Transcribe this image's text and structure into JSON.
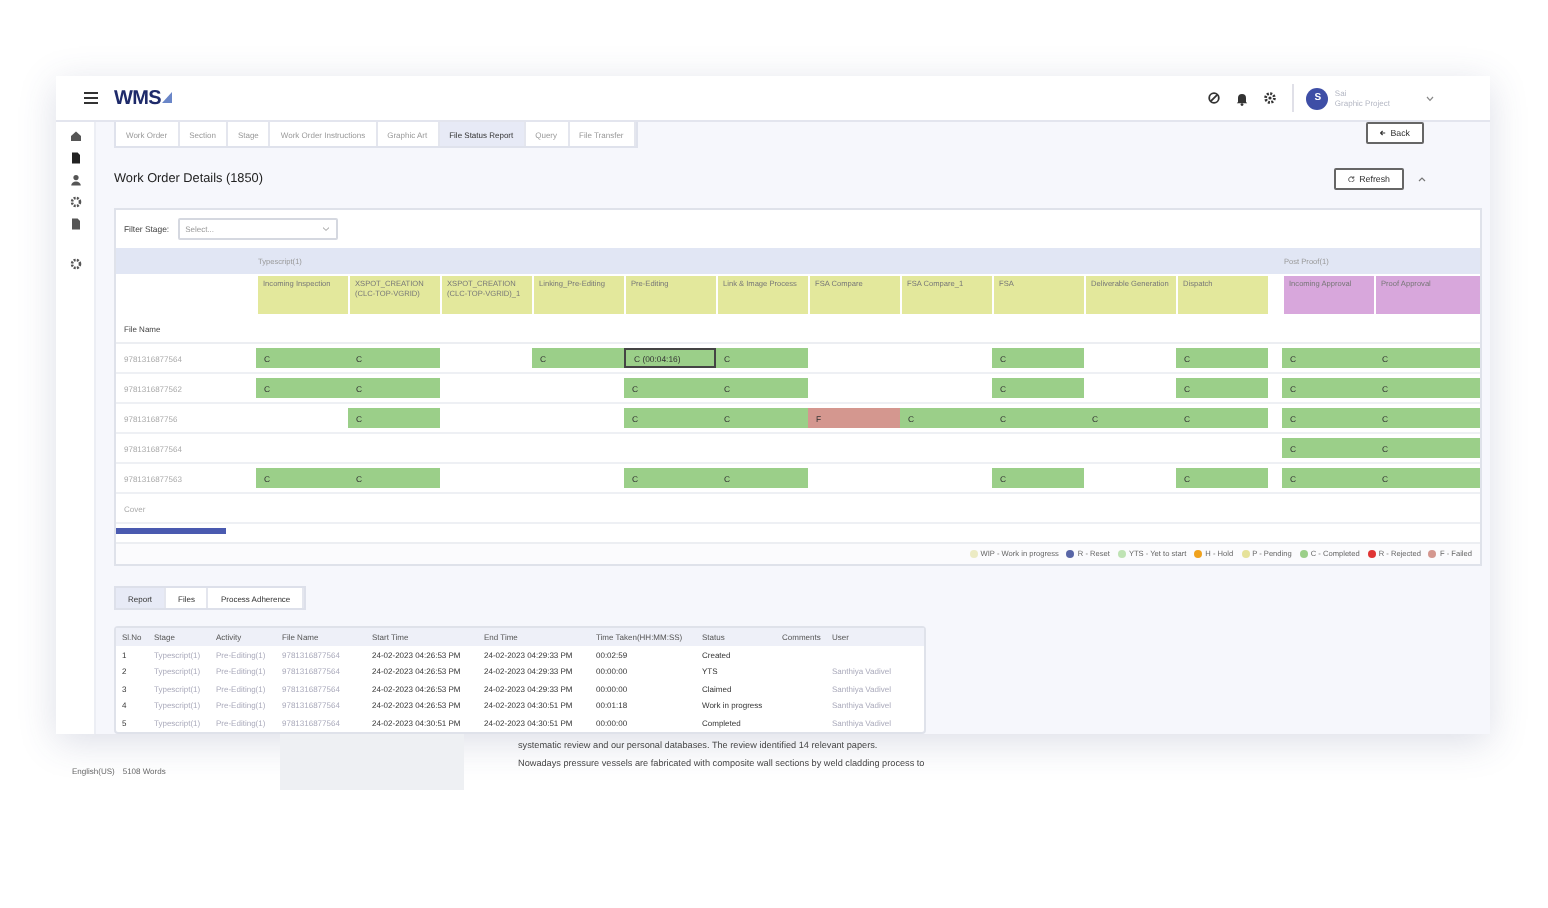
{
  "header": {
    "logo": "WMS",
    "user": {
      "initial": "S",
      "name": "Sai",
      "role": "Graphic Project"
    }
  },
  "tabs": [
    {
      "label": "Work Order",
      "selected": false
    },
    {
      "label": "Section",
      "selected": false
    },
    {
      "label": "Stage",
      "selected": false
    },
    {
      "label": "Work Order Instructions",
      "selected": false
    },
    {
      "label": "Graphic Art",
      "selected": false
    },
    {
      "label": "File Status Report",
      "selected": true
    },
    {
      "label": "Query",
      "selected": false
    },
    {
      "label": "File Transfer",
      "selected": false
    }
  ],
  "back_button": "Back",
  "title": "Work Order Details (1850)",
  "refresh_button": "Refresh",
  "filter": {
    "label": "Filter Stage:",
    "placeholder": "Select..."
  },
  "grid": {
    "file_name_header": "File Name",
    "groups": [
      {
        "label": "Typescript(1)",
        "color": "#e3e89c",
        "columns": [
          "Incoming Inspection",
          "XSPOT_CREATION (CLC-TOP-VGRID)",
          "XSPOT_CREATION (CLC-TOP-VGRID)_1",
          "Linking_Pre-Editing",
          "Pre-Editing",
          "Link & Image Process",
          "FSA Compare",
          "FSA Compare_1",
          "FSA",
          "Deliverable Generation",
          "Dispatch"
        ]
      },
      {
        "label": "Post Proof(1)",
        "color": "#d8a7dc",
        "columns": [
          "Incoming Approval",
          "Proof Approval"
        ]
      }
    ],
    "rows": [
      {
        "file_name": "9781316877564",
        "cells": [
          {
            "text": "C",
            "kind": "completed",
            "selected": false
          },
          {
            "text": "C",
            "kind": "completed",
            "selected": false
          },
          null,
          {
            "text": "C",
            "kind": "completed",
            "selected": false
          },
          {
            "text": "C (00:04:16)",
            "kind": "completed",
            "selected": true
          },
          {
            "text": "C",
            "kind": "completed",
            "selected": false
          },
          null,
          null,
          {
            "text": "C",
            "kind": "completed",
            "selected": false
          },
          null,
          {
            "text": "C",
            "kind": "completed",
            "selected": false
          },
          {
            "text": "C",
            "kind": "completed",
            "selected": false
          },
          {
            "text": "C",
            "kind": "completed",
            "selected": false
          }
        ]
      },
      {
        "file_name": "9781316877562",
        "cells": [
          {
            "text": "C",
            "kind": "completed",
            "selected": false
          },
          {
            "text": "C",
            "kind": "completed",
            "selected": false
          },
          null,
          null,
          {
            "text": "C",
            "kind": "completed",
            "selected": false
          },
          {
            "text": "C",
            "kind": "completed",
            "selected": false
          },
          null,
          null,
          {
            "text": "C",
            "kind": "completed",
            "selected": false
          },
          null,
          {
            "text": "C",
            "kind": "completed",
            "selected": false
          },
          {
            "text": "C",
            "kind": "completed",
            "selected": false
          },
          {
            "text": "C",
            "kind": "completed",
            "selected": false
          }
        ]
      },
      {
        "file_name": "978131687756",
        "cells": [
          null,
          {
            "text": "C",
            "kind": "completed",
            "selected": false
          },
          null,
          null,
          {
            "text": "C",
            "kind": "completed",
            "selected": false
          },
          {
            "text": "C",
            "kind": "completed",
            "selected": false
          },
          {
            "text": "F",
            "kind": "failed",
            "selected": false
          },
          {
            "text": "C",
            "kind": "completed",
            "selected": false
          },
          {
            "text": "C",
            "kind": "completed",
            "selected": false
          },
          {
            "text": "C",
            "kind": "completed",
            "selected": false
          },
          {
            "text": "C",
            "kind": "completed",
            "selected": false
          },
          {
            "text": "C",
            "kind": "completed",
            "selected": false
          },
          {
            "text": "C",
            "kind": "completed",
            "selected": false
          }
        ]
      },
      {
        "file_name": "9781316877564",
        "cells": [
          null,
          null,
          null,
          null,
          null,
          null,
          null,
          null,
          null,
          null,
          null,
          {
            "text": "C",
            "kind": "completed",
            "selected": false
          },
          {
            "text": "C",
            "kind": "completed",
            "selected": false
          }
        ]
      },
      {
        "file_name": "9781316877563",
        "cells": [
          {
            "text": "C",
            "kind": "completed",
            "selected": false
          },
          {
            "text": "C",
            "kind": "completed",
            "selected": false
          },
          null,
          null,
          {
            "text": "C",
            "kind": "completed",
            "selected": false
          },
          {
            "text": "C",
            "kind": "completed",
            "selected": false
          },
          null,
          null,
          {
            "text": "C",
            "kind": "completed",
            "selected": false
          },
          null,
          {
            "text": "C",
            "kind": "completed",
            "selected": false
          },
          {
            "text": "C",
            "kind": "completed",
            "selected": false
          },
          {
            "text": "C",
            "kind": "completed",
            "selected": false
          }
        ]
      },
      {
        "file_name": "Cover",
        "cells": []
      }
    ]
  },
  "legend": [
    {
      "label": "WIP - Work in progress",
      "color": "#ecebc4"
    },
    {
      "label": "R - Reset",
      "color": "#5865a6"
    },
    {
      "label": "YTS - Yet to start",
      "color": "#bfe3b4"
    },
    {
      "label": "H - Hold",
      "color": "#f0a21e"
    },
    {
      "label": "P - Pending",
      "color": "#e6e29a"
    },
    {
      "label": "C - Completed",
      "color": "#9bcf89"
    },
    {
      "label": "R - Rejected",
      "color": "#e03434"
    },
    {
      "label": "F - Failed",
      "color": "#d4978f"
    }
  ],
  "report_tabs": [
    {
      "label": "Report",
      "selected": true
    },
    {
      "label": "Files",
      "selected": false
    },
    {
      "label": "Process Adherence",
      "selected": false
    }
  ],
  "report": {
    "columns": [
      "Sl.No",
      "Stage",
      "Activity",
      "File Name",
      "Start Time",
      "End Time",
      "Time Taken(HH:MM:SS)",
      "Status",
      "Comments",
      "User"
    ],
    "rows": [
      [
        "1",
        "Typescript(1)",
        "Pre-Editing(1)",
        "9781316877564",
        "24-02-2023 04:26:53 PM",
        "24-02-2023 04:29:33 PM",
        "00:02:59",
        "Created",
        "",
        ""
      ],
      [
        "2",
        "Typescript(1)",
        "Pre-Editing(1)",
        "9781316877564",
        "24-02-2023 04:26:53 PM",
        "24-02-2023 04:29:33 PM",
        "00:00:00",
        "YTS",
        "",
        "Santhiya Vadivel"
      ],
      [
        "3",
        "Typescript(1)",
        "Pre-Editing(1)",
        "9781316877564",
        "24-02-2023 04:26:53 PM",
        "24-02-2023 04:29:33 PM",
        "00:00:00",
        "Claimed",
        "",
        "Santhiya Vadivel"
      ],
      [
        "4",
        "Typescript(1)",
        "Pre-Editing(1)",
        "9781316877564",
        "24-02-2023 04:26:53 PM",
        "24-02-2023 04:30:51 PM",
        "00:01:18",
        "Work in progress",
        "",
        "Santhiya Vadivel"
      ],
      [
        "5",
        "Typescript(1)",
        "Pre-Editing(1)",
        "9781316877564",
        "24-02-2023 04:30:51 PM",
        "24-02-2023 04:30:51 PM",
        "00:00:00",
        "Completed",
        "",
        "Santhiya Vadivel"
      ]
    ]
  },
  "document": {
    "lines": [
      "systematic review and our personal databases. The review identified 14 relevant papers.",
      "Nowadays pressure vessels are fabricated with composite wall sections by weld cladding process to"
    ],
    "status_bar": [
      "English(US)",
      "5108 Words"
    ]
  }
}
